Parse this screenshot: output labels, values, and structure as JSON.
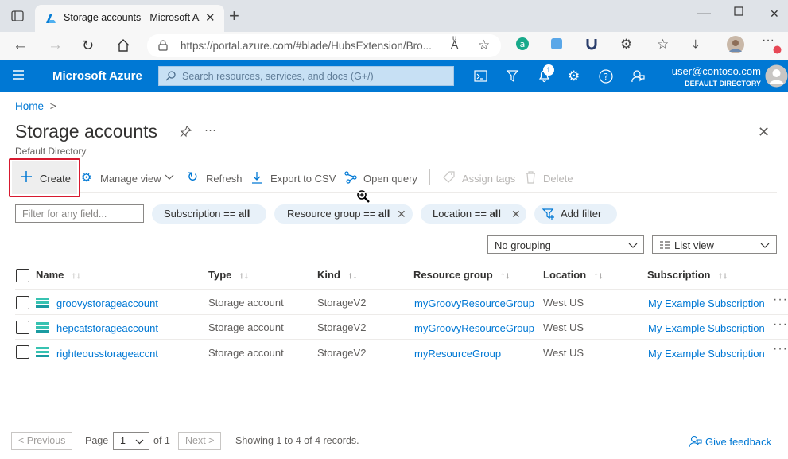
{
  "browser": {
    "tab_title": "Storage accounts - Microsoft Azure",
    "url": "https://portal.azure.com/#blade/HubsExtension/Bro..."
  },
  "topbar": {
    "brand": "Microsoft Azure",
    "search_placeholder": "Search resources, services, and docs (G+/)",
    "notification_count": "1",
    "user_email": "user@contoso.com",
    "user_directory": "DEFAULT DIRECTORY"
  },
  "page": {
    "breadcrumb_home": "Home",
    "breadcrumb_sep": ">",
    "title": "Storage accounts",
    "subtitle": "Default Directory"
  },
  "commands": {
    "create": "Create",
    "manage_view": "Manage view",
    "refresh": "Refresh",
    "export_csv": "Export to CSV",
    "open_query": "Open query",
    "assign_tags": "Assign tags",
    "delete": "Delete"
  },
  "filters": {
    "filter_placeholder": "Filter for any field...",
    "subscription_prefix": "Subscription == ",
    "subscription_value": "all",
    "resource_group_prefix": "Resource group == ",
    "resource_group_value": "all",
    "location_prefix": "Location == ",
    "location_value": "all",
    "add_filter": "Add filter"
  },
  "view_options": {
    "grouping": "No grouping",
    "view": "List view"
  },
  "table": {
    "columns": [
      "Name",
      "Type",
      "Kind",
      "Resource group",
      "Location",
      "Subscription"
    ],
    "rows": [
      {
        "name": "groovystorageaccount",
        "type": "Storage account",
        "kind": "StorageV2",
        "resource_group": "myGroovyResourceGroup",
        "location": "West US",
        "subscription": "My Example Subscription"
      },
      {
        "name": "hepcatstorageaccount",
        "type": "Storage account",
        "kind": "StorageV2",
        "resource_group": "myGroovyResourceGroup",
        "location": "West US",
        "subscription": "My Example Subscription"
      },
      {
        "name": "righteousstorageaccnt",
        "type": "Storage account",
        "kind": "StorageV2",
        "resource_group": "myResourceGroup",
        "location": "West US",
        "subscription": "My Example Subscription"
      }
    ]
  },
  "pagination": {
    "previous": "< Previous",
    "page_label": "Page",
    "page_value": "1",
    "of_label": "of 1",
    "next": "Next >",
    "status": "Showing 1 to 4 of 4 records."
  },
  "feedback": "Give feedback",
  "colors": {
    "azure_blue": "#0078d4",
    "highlight_red": "#d7192f",
    "pill_bg": "#e8f1f9"
  }
}
